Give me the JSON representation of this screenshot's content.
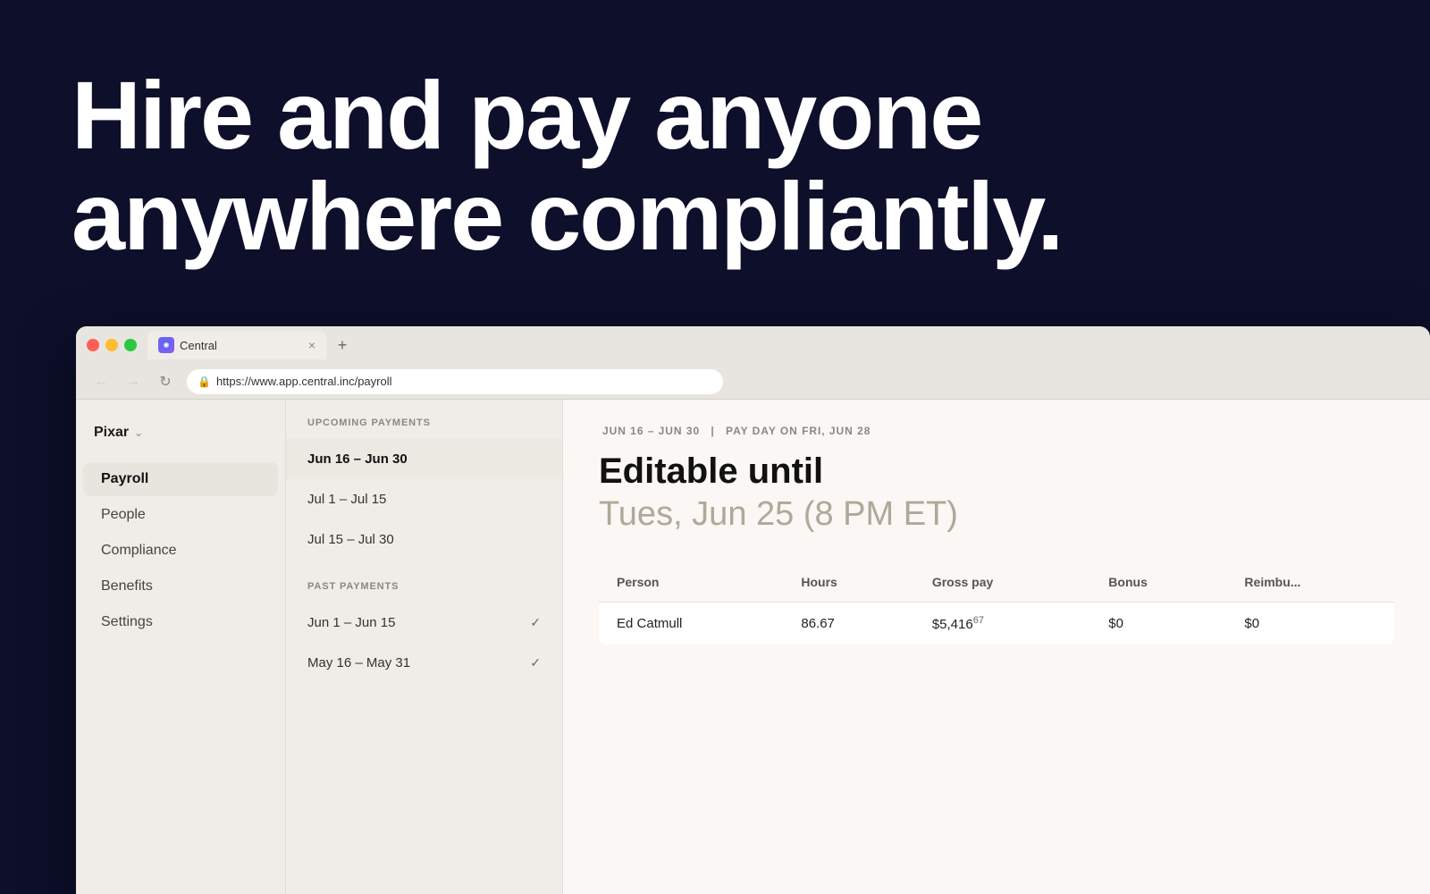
{
  "hero": {
    "line1": "Hire and pay anyone",
    "line2": "anywhere compliantly."
  },
  "browser": {
    "tab_title": "Central",
    "tab_favicon": "C",
    "url": "https://www.app.central.inc/payroll",
    "nav_back": "←",
    "nav_forward": "→",
    "nav_refresh": "↻"
  },
  "sidebar": {
    "org_name": "Pixar",
    "nav_items": [
      {
        "label": "Payroll",
        "active": true
      },
      {
        "label": "People",
        "active": false
      },
      {
        "label": "Compliance",
        "active": false
      },
      {
        "label": "Benefits",
        "active": false
      },
      {
        "label": "Settings",
        "active": false
      }
    ]
  },
  "payments_panel": {
    "upcoming_label": "Upcoming Payments",
    "upcoming_items": [
      {
        "range": "Jun 16 – Jun 30",
        "active": true
      },
      {
        "range": "Jul 1 – Jul 15",
        "active": false
      },
      {
        "range": "Jul 15 – Jul 30",
        "active": false
      }
    ],
    "past_label": "Past Payments",
    "past_items": [
      {
        "range": "Jun 1 – Jun 15",
        "checked": true
      },
      {
        "range": "May 16 – May 31",
        "checked": true
      }
    ]
  },
  "main": {
    "meta_range": "JUN 16 – JUN 30",
    "meta_separator": "|",
    "meta_payday": "PAY DAY ON FRI, JUN 28",
    "editable_label": "Editable until",
    "editable_date": "Tues, Jun 25 (8 PM ET)",
    "table": {
      "headers": [
        "Person",
        "Hours",
        "Gross pay",
        "Bonus",
        "Reimbu..."
      ],
      "rows": [
        {
          "person": "Ed Catmull",
          "hours": "86.67",
          "gross_pay": "$5,416",
          "gross_sup": "67",
          "bonus": "$0",
          "reimbu": "$0"
        }
      ]
    }
  }
}
